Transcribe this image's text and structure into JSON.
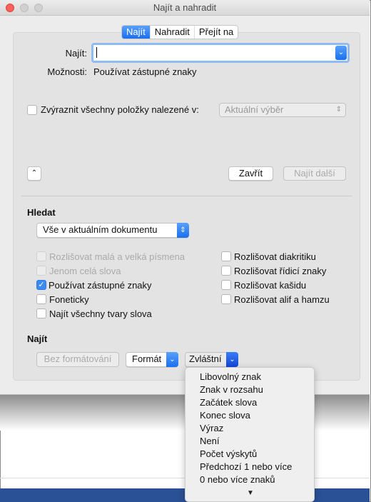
{
  "window": {
    "title": "Najít a nahradit"
  },
  "tabs": [
    {
      "label": "Najít",
      "active": true
    },
    {
      "label": "Nahradit",
      "active": false
    },
    {
      "label": "Přejít na",
      "active": false
    }
  ],
  "find": {
    "label": "Najít:",
    "value": "",
    "options_label": "Možnosti:",
    "options_value": "Používat zástupné znaky"
  },
  "highlight": {
    "label": "Zvýraznit všechny položky nalezené v:",
    "checked": false,
    "select_value": "Aktuální výběr"
  },
  "buttons": {
    "close": "Zavřít",
    "find_next": "Najít další"
  },
  "search": {
    "heading": "Hledat",
    "scope": "Vše v aktuálním dokumentu"
  },
  "options_left": [
    {
      "label": "Rozlišovat malá a velká písmena",
      "checked": false,
      "disabled": true
    },
    {
      "label": "Jenom celá slova",
      "checked": false,
      "disabled": true
    },
    {
      "label": "Používat zástupné znaky",
      "checked": true,
      "disabled": false
    },
    {
      "label": "Foneticky",
      "checked": false,
      "disabled": false
    },
    {
      "label": "Najít všechny tvary slova",
      "checked": false,
      "disabled": false
    }
  ],
  "options_right": [
    {
      "label": "Rozlišovat diakritiku",
      "checked": false
    },
    {
      "label": "Rozlišovat řídicí znaky",
      "checked": false
    },
    {
      "label": "Rozlišovat kašidu",
      "checked": false
    },
    {
      "label": "Rozlišovat alif a hamzu",
      "checked": false
    }
  ],
  "format": {
    "heading": "Najít",
    "no_format": "Bez formátování",
    "format": "Formát",
    "special": "Zvláštní"
  },
  "special_menu": [
    "Libovolný znak",
    "Znak v rozsahu",
    "Začátek slova",
    "Konec slova",
    "Výraz",
    "Není",
    "Počet výskytů",
    "Předchozí 1 nebo více",
    "0 nebo více znaků"
  ],
  "colors": {
    "accent": "#1a6ff0",
    "taskbar": "#2a5096",
    "close_light": "#fc605c"
  }
}
